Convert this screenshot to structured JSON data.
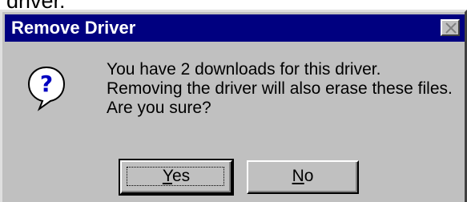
{
  "background_text": "driver.",
  "window": {
    "title": "Remove Driver",
    "close_icon": "close-icon"
  },
  "icon": "question-icon",
  "message": {
    "line1": "You have 2 downloads for this driver.",
    "line2": "Removing the driver will also erase these files.",
    "line3": "Are you sure?"
  },
  "buttons": {
    "yes_mnemonic": "Y",
    "yes_rest": "es",
    "no_mnemonic": "N",
    "no_rest": "o"
  },
  "colors": {
    "titlebar": "#000080",
    "dialog_face": "#c0c0c0"
  }
}
